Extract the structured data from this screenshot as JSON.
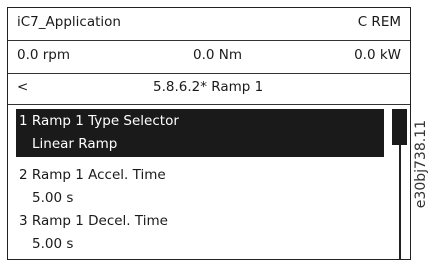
{
  "header": {
    "app_name": "iC7_Application",
    "rem_icon": "refresh-icon",
    "rem_label": "C REM",
    "speed": "0.0 rpm",
    "torque": "0.0 Nm",
    "power": "0.0 kW"
  },
  "nav": {
    "back_label": "<",
    "title": "5.8.6.2* Ramp 1"
  },
  "params": [
    {
      "name": "1 Ramp 1 Type Selector",
      "value": "Linear Ramp",
      "selected": true
    },
    {
      "name": "2 Ramp 1 Accel. Time",
      "value": "5.00 s",
      "selected": false
    },
    {
      "name": "3 Ramp 1 Decel. Time",
      "value": "5.00 s",
      "selected": false
    }
  ],
  "figure_id": "e30bj738.11"
}
